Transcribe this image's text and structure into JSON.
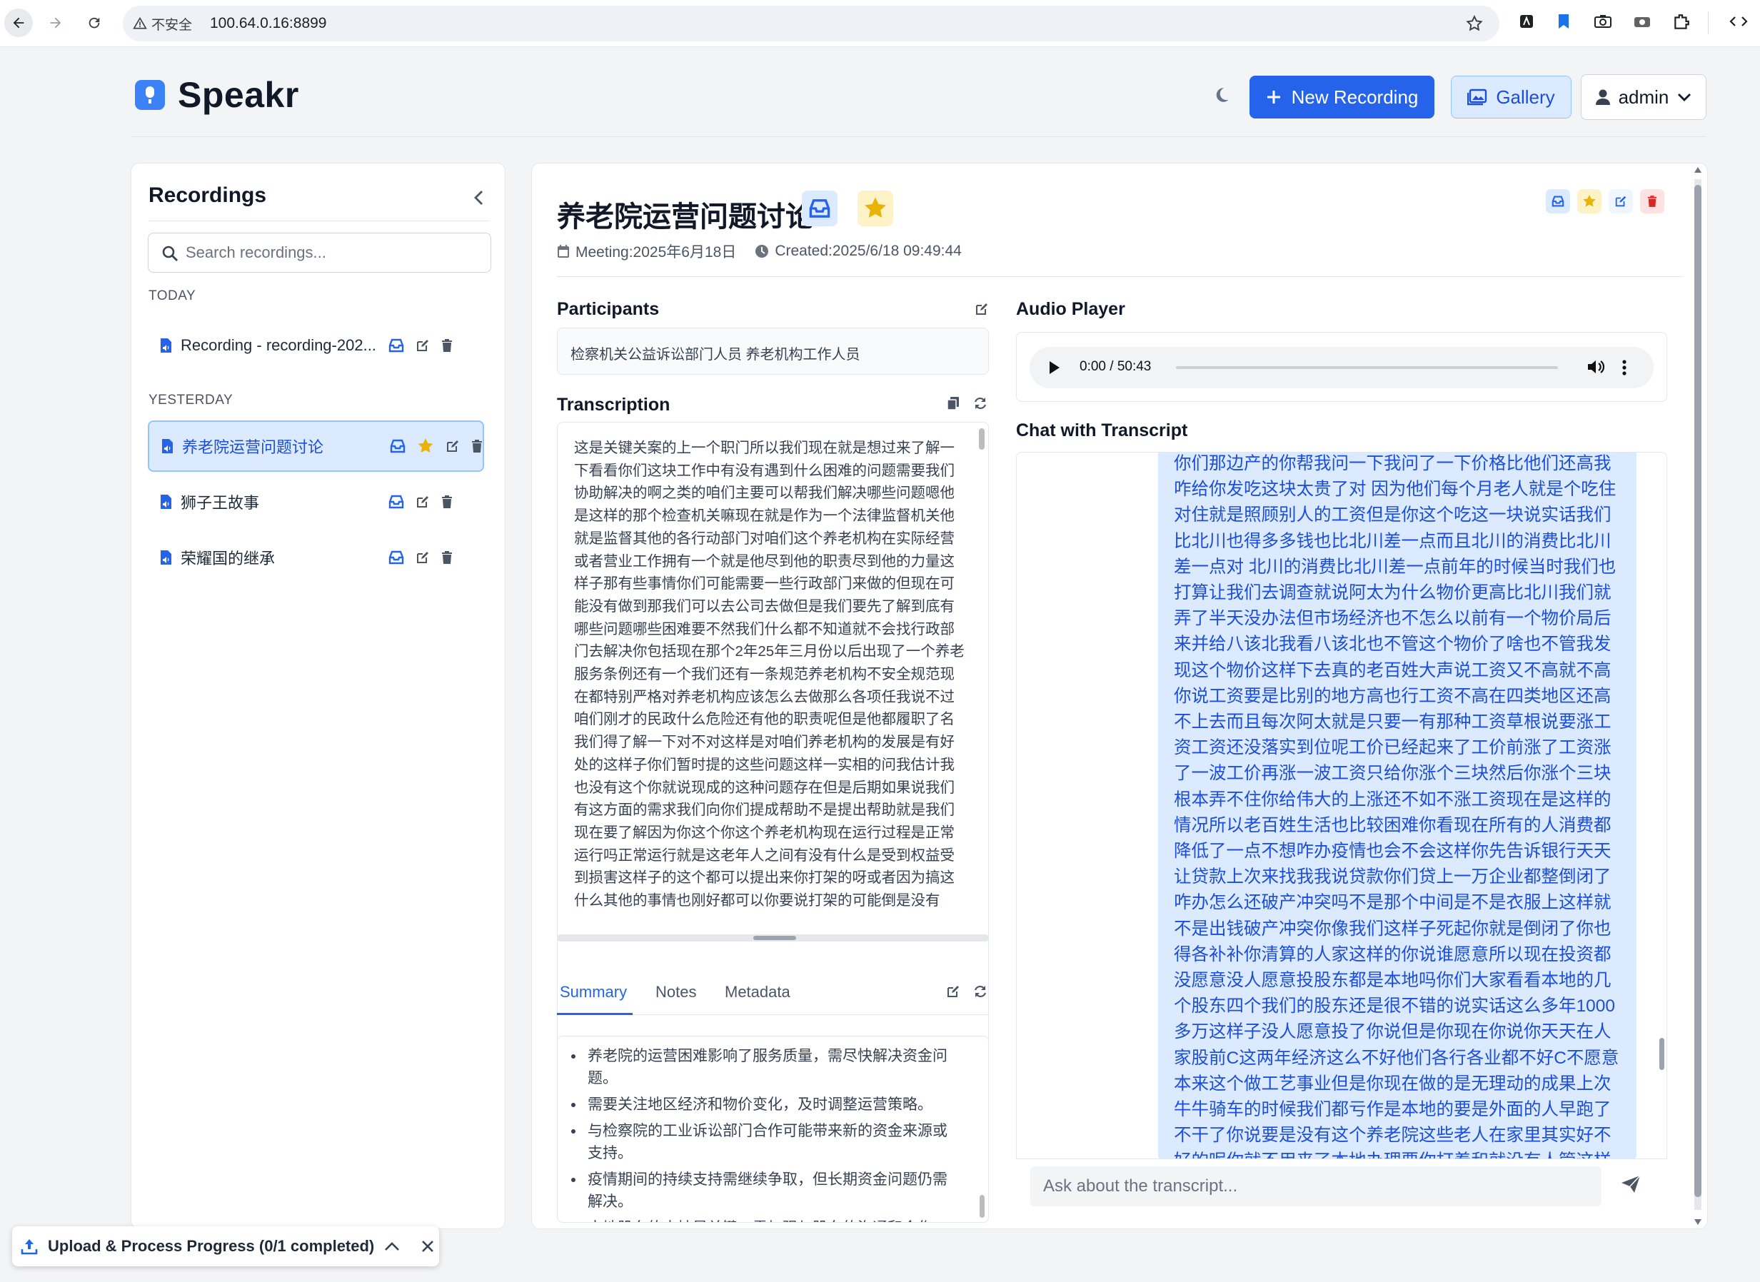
{
  "browser": {
    "security_label": "不安全",
    "url": "100.64.0.16:8899"
  },
  "header": {
    "brand": "Speakr",
    "new_recording_label": "New Recording",
    "gallery_label": "Gallery",
    "user_label": "admin"
  },
  "sidebar": {
    "title": "Recordings",
    "search_placeholder": "Search recordings...",
    "groups": [
      {
        "label": "TODAY",
        "items": [
          {
            "name": "Recording - recording-202..."
          }
        ]
      },
      {
        "label": "YESTERDAY",
        "items": [
          {
            "name": "养老院运营问题讨论",
            "starred": true,
            "active": true
          },
          {
            "name": "狮子王故事"
          },
          {
            "name": "荣耀国的继承"
          }
        ]
      }
    ]
  },
  "main": {
    "title": "养老院运营问题讨论",
    "meeting_label": "Meeting:2025年6月18日",
    "created_label": "Created:2025/6/18 09:49:44",
    "participants_heading": "Participants",
    "participants": "检察机关公益诉讼部门人员 养老机构工作人员",
    "transcription_heading": "Transcription",
    "transcription": "这是关键关案的上一个职门所以我们现在就是想过来了解一下看看你们这块工作中有没有遇到什么困难的问题需要我们协助解决的啊之类的咱们主要可以帮我们解决哪些问题嗯他是这样的那个检查机关嘛现在就是作为一个法律监督机关他就是监督其他的各行动部门对咱们这个养老机构在实际经营或者营业工作拥有一个就是他尽到他的职责尽到他的力量这样子那有些事情你们可能需要一些行政部门来做的但现在可能没有做到那我们可以去公司去做但是我们要先了解到底有哪些问题哪些困难要不然我们什么都不知道就不会找行政部门去解决你包括现在那个2年25年三月份以后出现了一个养老服务条例还有一个我们还有一条规范养老机构不安全规范现在都特别严格对养老机构应该怎么去做那么各项任我说不过咱们刚才的民政什么危险还有他的职责呢但是他都履职了名我们得了解一下对不对这样是对咱们养老机构的发展是有好处的这样子你们暂时提的这些问题这样一实相的问我估计我也没有这个你就说现成的这种问题存在但是后期如果说我们有这方面的需求我们向你们提成帮助不是提出帮助就是我们现在要了解因为你这个你这个养老机构现在运行过程是正常运行吗正常运行就是这老年人之间有没有什么是受到权益受到损害这样子的这个都可以提出来你打架的呀或者因为搞这什么其他的事情也刚好都可以你要说打架的可能倒是没有",
    "tabs": [
      "Summary",
      "Notes",
      "Metadata"
    ],
    "summary_items": [
      "养老院的运营困难影响了服务质量，需尽快解决资金问题。",
      "需要关注地区经济和物价变化，及时调整运营策略。",
      "与检察院的工业诉讼部门合作可能带来新的资金来源或支持。",
      "疫情期间的持续支持需继续争取，但长期资金问题仍需解决。",
      "本地股东的支持是关键，需加强与股东的沟通和合作。"
    ]
  },
  "audio": {
    "heading": "Audio Player",
    "time": "0:00 / 50:43"
  },
  "chat": {
    "heading": "Chat with Transcript",
    "message": "你们那边产的你帮我问一下我问了一下价格比他们还高我咋给你发吃这块太贵了对 因为他们每个月老人就是个吃住对住就是照顾别人的工资但是你这个吃这一块说实话我们比北川也得多多钱也比北川差一点而且北川的消费比北川差一点对 北川的消费比北川差一点前年的时候当时我们也打算让我们去调查就说阿太为什么物价更高比北川我们就弄了半天没办法但市场经济也不怎么以前有一个物价局后来并给八该北我看八该北也不管这个物价了啥也不管我发现这个物价这样下去真的老百姓大声说工资又不高就不高你说工资要是比别的地方高也行工资不高在四类地区还高不上去而且每次阿太就是只要一有那种工资草根说要涨工资工资还没落实到位呢工价已经起来了工价前涨了工资涨了一波工价再涨一波工资只给你涨个三块然后你涨个三块根本弄不住你给伟大的上涨还不如不涨工资现在是这样的情况所以老百姓生活也比较困难你看现在所有的人消费都降低了一点不想咋办疫情也会不会这样你先告诉银行天天让贷款上次来找我我说贷款你们贷上一万企业都整倒闭了咋办怎么还破产冲突吗不是那个中间是不是衣服上这样就不是出钱破产冲突你像我们这样子死起你就是倒闭了你也得各补补你清算的人家这样的你说谁愿意所以现在投资都没愿意没人愿意投股东都是本地吗你们大家看看本地的几个股东四个我们的股东还是很不错的说实话这么多年1000多万这样子没人愿意投了你说但是你现在你说你天天在人家股前C这两年经济这么不好他们各行各业都不好C不愿意本来这个做工艺事业但是你现在做的是无理动的成果上次牛牛骑车的时候我们都亏作是本地的要是外面的人早跑了不干了你说要是没有这个养老院这些老人在家里其实好不好的呢你就不用来了本地办理要你打着和就没有人管这样",
    "input_placeholder": "Ask about the transcript..."
  },
  "toast": {
    "label": "Upload & Process Progress (0/1 completed)"
  },
  "colors": {
    "primary": "#2563eb",
    "star": "#eab308",
    "delete": "#dc2626",
    "active_bg": "#dbeafe"
  }
}
